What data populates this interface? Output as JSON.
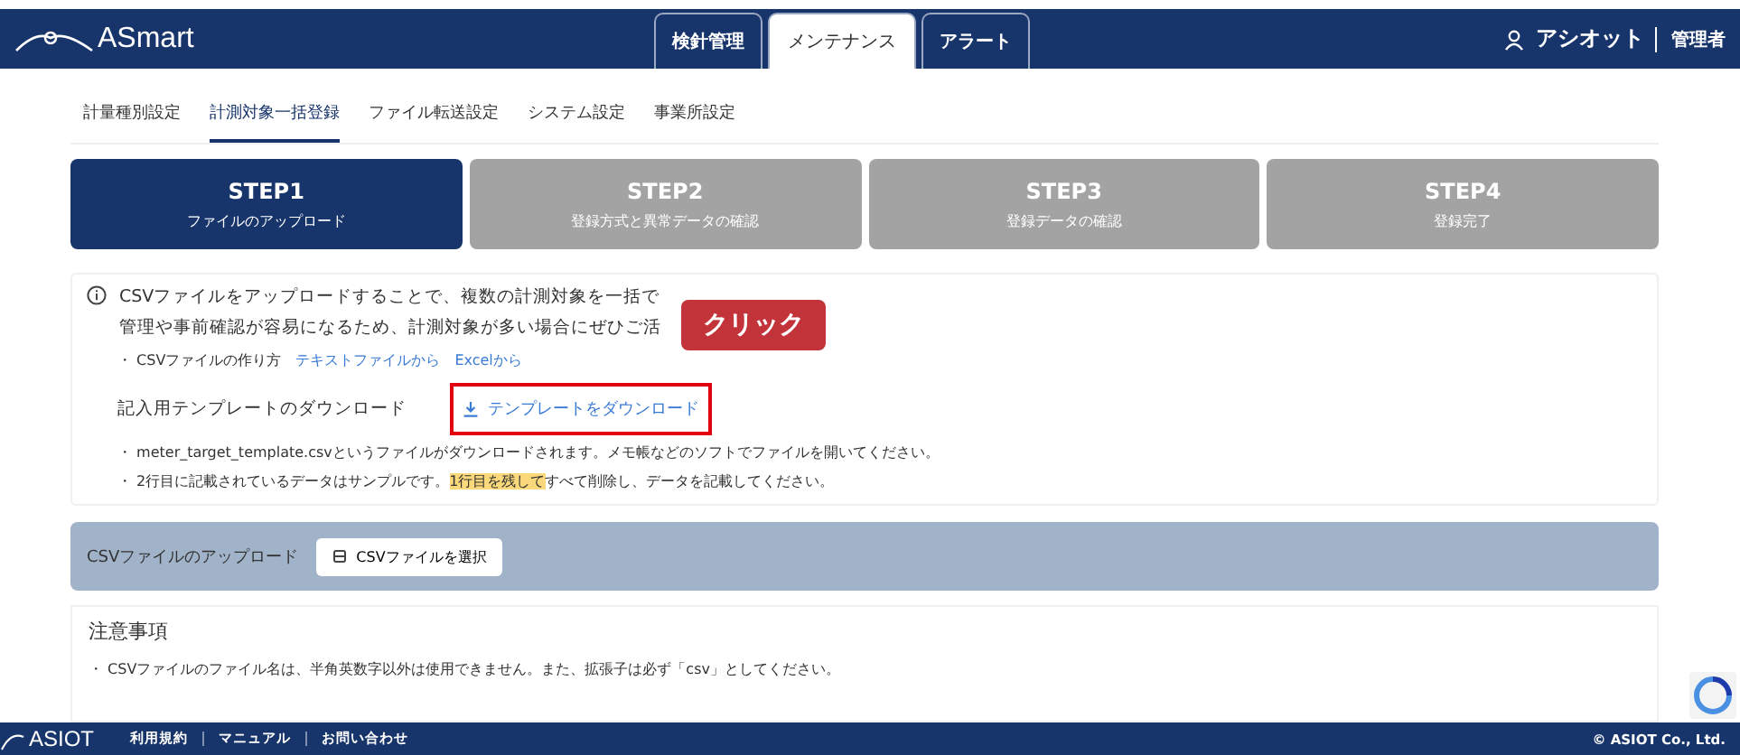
{
  "header": {
    "logo": "ASmart",
    "tabs": [
      {
        "label": "検針管理",
        "selected": false
      },
      {
        "label": "メンテナンス",
        "selected": true
      },
      {
        "label": "アラート",
        "selected": false
      }
    ],
    "user": "アシオット",
    "role": "管理者"
  },
  "subnav": [
    {
      "label": "計量種別設定",
      "selected": false
    },
    {
      "label": "計測対象一括登録",
      "selected": true
    },
    {
      "label": "ファイル転送設定",
      "selected": false
    },
    {
      "label": "システム設定",
      "selected": false
    },
    {
      "label": "事業所設定",
      "selected": false
    }
  ],
  "steps": [
    {
      "title": "STEP1",
      "subtitle": "ファイルのアップロード",
      "selected": true
    },
    {
      "title": "STEP2",
      "subtitle": "登録方式と異常データの確認",
      "selected": false
    },
    {
      "title": "STEP3",
      "subtitle": "登録データの確認",
      "selected": false
    },
    {
      "title": "STEP4",
      "subtitle": "登録完了",
      "selected": false
    }
  ],
  "info": {
    "lines": [
      "CSVファイルをアップロードすることで、複数の計測対象を一括で",
      "管理や事前確認が容易になるため、計測対象が多い場合にぜひご活"
    ],
    "howto_label": "・ CSVファイルの作り方",
    "howto_links": [
      "テキストファイルから",
      "Excelから"
    ],
    "template_label": "記入用テンプレートのダウンロード",
    "template_button": "テンプレートをダウンロード",
    "notes": [
      "・ meter_target_template.csvというファイルがダウンロードされます。メモ帳などのソフトでファイルを開いてください。",
      "・ 2行目に記載されているデータはサンプルです。**1行目を残して**すべて削除し、データを記載してください。"
    ],
    "callout": "クリック"
  },
  "upload": {
    "label": "CSVファイルのアップロード",
    "button": "CSVファイルを選択"
  },
  "caution": {
    "title": "注意事項",
    "items": [
      "・ CSVファイルのファイル名は、半角英数字以外は使用できません。また、拡張子は必ず「csv」としてください。"
    ]
  },
  "footer": {
    "logo": "ASIOT",
    "links": [
      "利用規約",
      "マニュアル",
      "お問い合わせ"
    ],
    "copyright": "© ASIOT Co., Ltd."
  }
}
